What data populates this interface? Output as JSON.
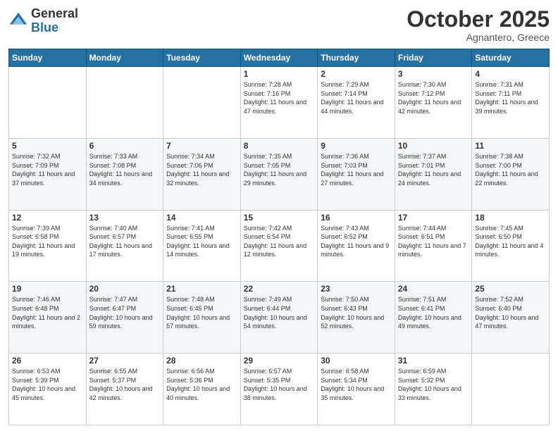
{
  "header": {
    "logo_line1": "General",
    "logo_line2": "Blue",
    "month": "October 2025",
    "location": "Agnantero, Greece"
  },
  "days_of_week": [
    "Sunday",
    "Monday",
    "Tuesday",
    "Wednesday",
    "Thursday",
    "Friday",
    "Saturday"
  ],
  "weeks": [
    [
      {
        "num": "",
        "sunrise": "",
        "sunset": "",
        "daylight": ""
      },
      {
        "num": "",
        "sunrise": "",
        "sunset": "",
        "daylight": ""
      },
      {
        "num": "",
        "sunrise": "",
        "sunset": "",
        "daylight": ""
      },
      {
        "num": "1",
        "sunrise": "Sunrise: 7:28 AM",
        "sunset": "Sunset: 7:16 PM",
        "daylight": "Daylight: 11 hours and 47 minutes."
      },
      {
        "num": "2",
        "sunrise": "Sunrise: 7:29 AM",
        "sunset": "Sunset: 7:14 PM",
        "daylight": "Daylight: 11 hours and 44 minutes."
      },
      {
        "num": "3",
        "sunrise": "Sunrise: 7:30 AM",
        "sunset": "Sunset: 7:12 PM",
        "daylight": "Daylight: 11 hours and 42 minutes."
      },
      {
        "num": "4",
        "sunrise": "Sunrise: 7:31 AM",
        "sunset": "Sunset: 7:11 PM",
        "daylight": "Daylight: 11 hours and 39 minutes."
      }
    ],
    [
      {
        "num": "5",
        "sunrise": "Sunrise: 7:32 AM",
        "sunset": "Sunset: 7:09 PM",
        "daylight": "Daylight: 11 hours and 37 minutes."
      },
      {
        "num": "6",
        "sunrise": "Sunrise: 7:33 AM",
        "sunset": "Sunset: 7:08 PM",
        "daylight": "Daylight: 11 hours and 34 minutes."
      },
      {
        "num": "7",
        "sunrise": "Sunrise: 7:34 AM",
        "sunset": "Sunset: 7:06 PM",
        "daylight": "Daylight: 11 hours and 32 minutes."
      },
      {
        "num": "8",
        "sunrise": "Sunrise: 7:35 AM",
        "sunset": "Sunset: 7:05 PM",
        "daylight": "Daylight: 11 hours and 29 minutes."
      },
      {
        "num": "9",
        "sunrise": "Sunrise: 7:36 AM",
        "sunset": "Sunset: 7:03 PM",
        "daylight": "Daylight: 11 hours and 27 minutes."
      },
      {
        "num": "10",
        "sunrise": "Sunrise: 7:37 AM",
        "sunset": "Sunset: 7:01 PM",
        "daylight": "Daylight: 11 hours and 24 minutes."
      },
      {
        "num": "11",
        "sunrise": "Sunrise: 7:38 AM",
        "sunset": "Sunset: 7:00 PM",
        "daylight": "Daylight: 11 hours and 22 minutes."
      }
    ],
    [
      {
        "num": "12",
        "sunrise": "Sunrise: 7:39 AM",
        "sunset": "Sunset: 6:58 PM",
        "daylight": "Daylight: 11 hours and 19 minutes."
      },
      {
        "num": "13",
        "sunrise": "Sunrise: 7:40 AM",
        "sunset": "Sunset: 6:57 PM",
        "daylight": "Daylight: 11 hours and 17 minutes."
      },
      {
        "num": "14",
        "sunrise": "Sunrise: 7:41 AM",
        "sunset": "Sunset: 6:55 PM",
        "daylight": "Daylight: 11 hours and 14 minutes."
      },
      {
        "num": "15",
        "sunrise": "Sunrise: 7:42 AM",
        "sunset": "Sunset: 6:54 PM",
        "daylight": "Daylight: 11 hours and 12 minutes."
      },
      {
        "num": "16",
        "sunrise": "Sunrise: 7:43 AM",
        "sunset": "Sunset: 6:52 PM",
        "daylight": "Daylight: 11 hours and 9 minutes."
      },
      {
        "num": "17",
        "sunrise": "Sunrise: 7:44 AM",
        "sunset": "Sunset: 6:51 PM",
        "daylight": "Daylight: 11 hours and 7 minutes."
      },
      {
        "num": "18",
        "sunrise": "Sunrise: 7:45 AM",
        "sunset": "Sunset: 6:50 PM",
        "daylight": "Daylight: 11 hours and 4 minutes."
      }
    ],
    [
      {
        "num": "19",
        "sunrise": "Sunrise: 7:46 AM",
        "sunset": "Sunset: 6:48 PM",
        "daylight": "Daylight: 11 hours and 2 minutes."
      },
      {
        "num": "20",
        "sunrise": "Sunrise: 7:47 AM",
        "sunset": "Sunset: 6:47 PM",
        "daylight": "Daylight: 10 hours and 59 minutes."
      },
      {
        "num": "21",
        "sunrise": "Sunrise: 7:48 AM",
        "sunset": "Sunset: 6:45 PM",
        "daylight": "Daylight: 10 hours and 57 minutes."
      },
      {
        "num": "22",
        "sunrise": "Sunrise: 7:49 AM",
        "sunset": "Sunset: 6:44 PM",
        "daylight": "Daylight: 10 hours and 54 minutes."
      },
      {
        "num": "23",
        "sunrise": "Sunrise: 7:50 AM",
        "sunset": "Sunset: 6:43 PM",
        "daylight": "Daylight: 10 hours and 52 minutes."
      },
      {
        "num": "24",
        "sunrise": "Sunrise: 7:51 AM",
        "sunset": "Sunset: 6:41 PM",
        "daylight": "Daylight: 10 hours and 49 minutes."
      },
      {
        "num": "25",
        "sunrise": "Sunrise: 7:52 AM",
        "sunset": "Sunset: 6:40 PM",
        "daylight": "Daylight: 10 hours and 47 minutes."
      }
    ],
    [
      {
        "num": "26",
        "sunrise": "Sunrise: 6:53 AM",
        "sunset": "Sunset: 5:39 PM",
        "daylight": "Daylight: 10 hours and 45 minutes."
      },
      {
        "num": "27",
        "sunrise": "Sunrise: 6:55 AM",
        "sunset": "Sunset: 5:37 PM",
        "daylight": "Daylight: 10 hours and 42 minutes."
      },
      {
        "num": "28",
        "sunrise": "Sunrise: 6:56 AM",
        "sunset": "Sunset: 5:36 PM",
        "daylight": "Daylight: 10 hours and 40 minutes."
      },
      {
        "num": "29",
        "sunrise": "Sunrise: 6:57 AM",
        "sunset": "Sunset: 5:35 PM",
        "daylight": "Daylight: 10 hours and 38 minutes."
      },
      {
        "num": "30",
        "sunrise": "Sunrise: 6:58 AM",
        "sunset": "Sunset: 5:34 PM",
        "daylight": "Daylight: 10 hours and 35 minutes."
      },
      {
        "num": "31",
        "sunrise": "Sunrise: 6:59 AM",
        "sunset": "Sunset: 5:32 PM",
        "daylight": "Daylight: 10 hours and 33 minutes."
      },
      {
        "num": "",
        "sunrise": "",
        "sunset": "",
        "daylight": ""
      }
    ]
  ]
}
